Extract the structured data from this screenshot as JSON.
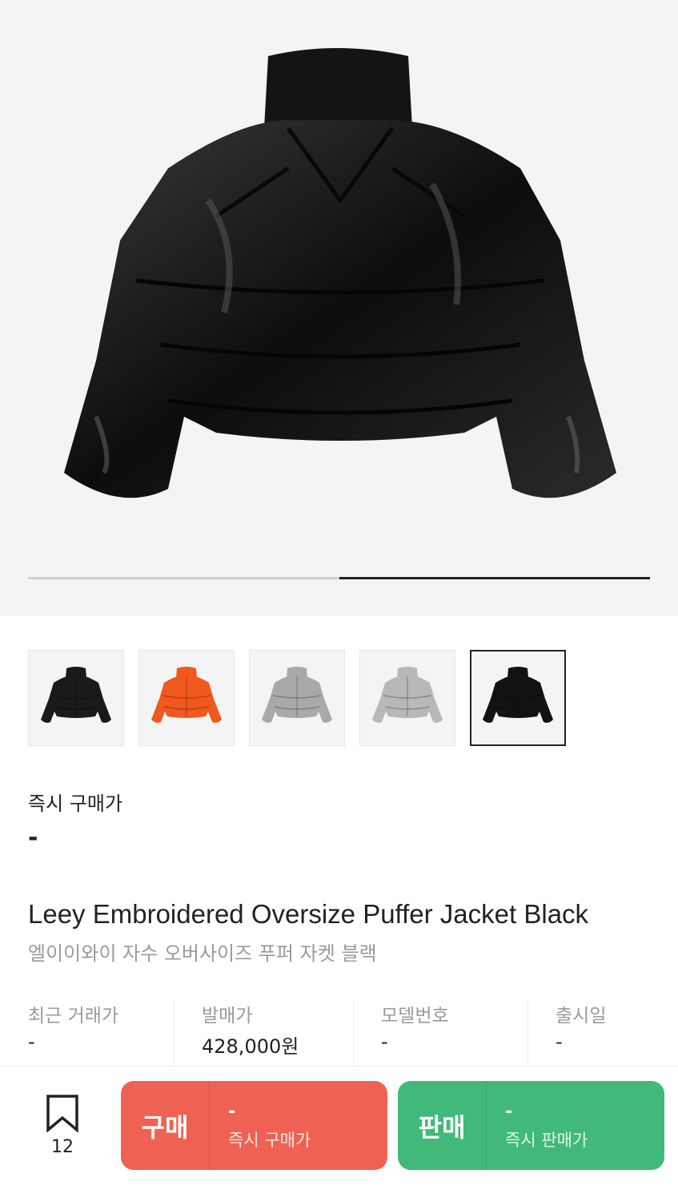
{
  "hero": {
    "image_icon": "black-puffer-jacket-back-image",
    "carousel_progress": 0.5
  },
  "thumbnails": [
    {
      "name": "black",
      "color": "#1a1a1a"
    },
    {
      "name": "orange",
      "color": "#f0581e"
    },
    {
      "name": "silver-grey",
      "color": "#a9a9a9"
    },
    {
      "name": "light-grey",
      "color": "#b8b8b8"
    },
    {
      "name": "black-back",
      "color": "#121212",
      "selected": true
    }
  ],
  "price": {
    "label": "즉시 구매가",
    "value": "-"
  },
  "product": {
    "title_en": "Leey Embroidered Oversize Puffer Jacket Black",
    "title_ko": "엘이이와이 자수 오버사이즈 푸퍼 자켓 블랙"
  },
  "info": [
    {
      "key": "최근 거래가",
      "value": "-"
    },
    {
      "key": "발매가",
      "value": "428,000원"
    },
    {
      "key": "모델번호",
      "value": "-"
    },
    {
      "key": "출시일",
      "value": "-"
    }
  ],
  "bottom_bar": {
    "bookmark_count": "12",
    "buy": {
      "label": "구매",
      "price": "-",
      "sub": "즉시 구매가"
    },
    "sell": {
      "label": "판매",
      "price": "-",
      "sub": "즉시 판매가"
    }
  },
  "colors": {
    "buy": "#ef6253",
    "sell": "#41b979",
    "hero_bg": "#f4f4f4"
  }
}
